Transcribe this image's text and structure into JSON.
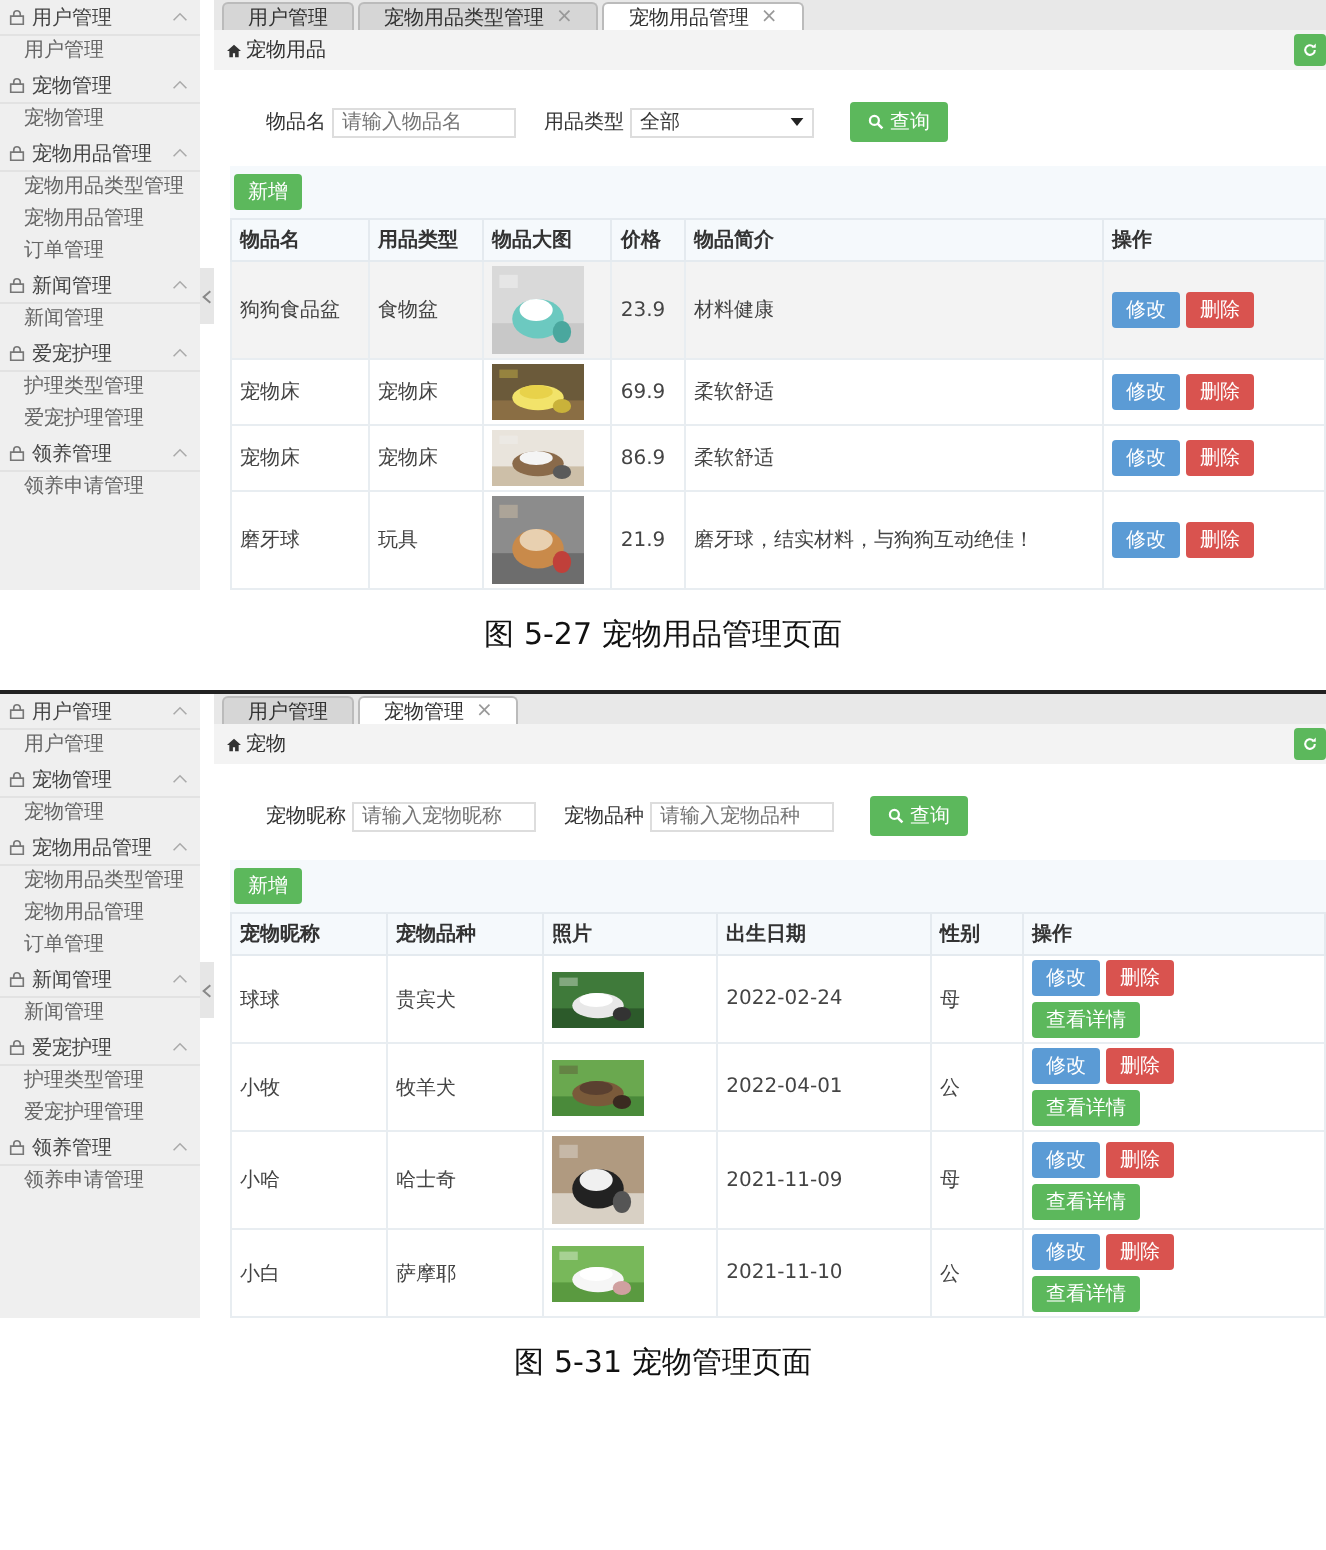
{
  "figures": [
    {
      "sidebar": [
        {
          "title": "用户管理",
          "expanded": true,
          "children": [
            "用户管理"
          ]
        },
        {
          "title": "宠物管理",
          "expanded": true,
          "children": [
            "宠物管理"
          ]
        },
        {
          "title": "宠物用品管理",
          "expanded": true,
          "children": [
            "宠物用品类型管理",
            "宠物用品管理",
            "订单管理"
          ]
        },
        {
          "title": "新闻管理",
          "expanded": true,
          "children": [
            "新闻管理"
          ]
        },
        {
          "title": "爱宠护理",
          "expanded": true,
          "children": [
            "护理类型管理",
            "爱宠护理管理"
          ]
        },
        {
          "title": "领养管理",
          "expanded": true,
          "children": [
            "领养申请管理"
          ]
        }
      ],
      "tabs": [
        {
          "label": "用户管理",
          "selected": false
        },
        {
          "label": "宠物用品类型管理",
          "close": "×",
          "selected": false
        },
        {
          "label": "宠物用品管理",
          "close": "×",
          "selected": true
        }
      ],
      "breadcrumb": "宠物用品",
      "filters": [
        {
          "kind": "input",
          "label": "物品名",
          "placeholder": "请输入物品名"
        },
        {
          "kind": "select",
          "label": "用品类型",
          "value": "全部"
        }
      ],
      "search_button": "查询",
      "add_button": "新增",
      "table": {
        "columns": [
          "物品名",
          "用品类型",
          "物品大图",
          "价格",
          "物品简介",
          "操作"
        ],
        "rows": [
          {
            "highlighted": true,
            "cells": [
              {
                "kind": "text",
                "text": "狗狗食品盆"
              },
              {
                "kind": "text",
                "text": "食物盆"
              },
              {
                "kind": "picture",
                "tall": true
              },
              {
                "kind": "text",
                "text": "23.9"
              },
              {
                "kind": "text",
                "text": "材料健康"
              },
              {
                "kind": "actions",
                "buttons": [
                  {
                    "kind": "edit",
                    "label": "修改"
                  },
                  {
                    "kind": "delete",
                    "label": "删除"
                  }
                ]
              }
            ]
          },
          {
            "highlighted": false,
            "cells": [
              {
                "kind": "text",
                "text": "宠物床"
              },
              {
                "kind": "text",
                "text": "宠物床"
              },
              {
                "kind": "picture",
                "tall": false
              },
              {
                "kind": "text",
                "text": "69.9"
              },
              {
                "kind": "text",
                "text": "柔软舒适"
              },
              {
                "kind": "actions",
                "buttons": [
                  {
                    "kind": "edit",
                    "label": "修改"
                  },
                  {
                    "kind": "delete",
                    "label": "删除"
                  }
                ]
              }
            ]
          },
          {
            "highlighted": false,
            "cells": [
              {
                "kind": "text",
                "text": "宠物床"
              },
              {
                "kind": "text",
                "text": "宠物床"
              },
              {
                "kind": "picture",
                "tall": false
              },
              {
                "kind": "text",
                "text": "86.9"
              },
              {
                "kind": "text",
                "text": "柔软舒适"
              },
              {
                "kind": "actions",
                "buttons": [
                  {
                    "kind": "edit",
                    "label": "修改"
                  },
                  {
                    "kind": "delete",
                    "label": "删除"
                  }
                ]
              }
            ]
          },
          {
            "highlighted": false,
            "cells": [
              {
                "kind": "text",
                "text": "磨牙球"
              },
              {
                "kind": "text",
                "text": "玩具"
              },
              {
                "kind": "picture",
                "tall": true
              },
              {
                "kind": "text",
                "text": "21.9"
              },
              {
                "kind": "text",
                "text": "磨牙球，结实材料，与狗狗互动绝佳！"
              },
              {
                "kind": "actions",
                "buttons": [
                  {
                    "kind": "edit",
                    "label": "修改"
                  },
                  {
                    "kind": "delete",
                    "label": "删除"
                  }
                ]
              }
            ]
          }
        ]
      },
      "caption": "图 5-27 宠物用品管理页面"
    },
    {
      "sidebar": [
        {
          "title": "用户管理",
          "expanded": true,
          "children": [
            "用户管理"
          ]
        },
        {
          "title": "宠物管理",
          "expanded": true,
          "children": [
            "宠物管理"
          ]
        },
        {
          "title": "宠物用品管理",
          "expanded": true,
          "children": [
            "宠物用品类型管理",
            "宠物用品管理",
            "订单管理"
          ]
        },
        {
          "title": "新闻管理",
          "expanded": true,
          "children": [
            "新闻管理"
          ]
        },
        {
          "title": "爱宠护理",
          "expanded": true,
          "children": [
            "护理类型管理",
            "爱宠护理管理"
          ]
        },
        {
          "title": "领养管理",
          "expanded": true,
          "children": [
            "领养申请管理"
          ]
        }
      ],
      "tabs": [
        {
          "label": "用户管理",
          "selected": false
        },
        {
          "label": "宠物管理",
          "close": "×",
          "selected": true
        }
      ],
      "breadcrumb": "宠物",
      "filters": [
        {
          "kind": "input",
          "label": "宠物昵称",
          "placeholder": "请输入宠物昵称"
        },
        {
          "kind": "input",
          "label": "宠物品种",
          "placeholder": "请输入宠物品种"
        }
      ],
      "search_button": "查询",
      "add_button": "新增",
      "table": {
        "columns": [
          "宠物昵称",
          "宠物品种",
          "照片",
          "出生日期",
          "性别",
          "操作"
        ],
        "rows": [
          {
            "highlighted": false,
            "cells": [
              {
                "kind": "text",
                "text": "球球"
              },
              {
                "kind": "text",
                "text": "贵宾犬"
              },
              {
                "kind": "picture",
                "tall": false
              },
              {
                "kind": "text",
                "text": "2022-02-24"
              },
              {
                "kind": "text",
                "text": "母"
              },
              {
                "kind": "actions",
                "buttons": [
                  {
                    "kind": "edit",
                    "label": "修改"
                  },
                  {
                    "kind": "delete",
                    "label": "删除"
                  },
                  {
                    "kind": "detail",
                    "label": "查看详情"
                  }
                ]
              }
            ]
          },
          {
            "highlighted": false,
            "cells": [
              {
                "kind": "text",
                "text": "小牧"
              },
              {
                "kind": "text",
                "text": "牧羊犬"
              },
              {
                "kind": "picture",
                "tall": false
              },
              {
                "kind": "text",
                "text": "2022-04-01"
              },
              {
                "kind": "text",
                "text": "公"
              },
              {
                "kind": "actions",
                "buttons": [
                  {
                    "kind": "edit",
                    "label": "修改"
                  },
                  {
                    "kind": "delete",
                    "label": "删除"
                  },
                  {
                    "kind": "detail",
                    "label": "查看详情"
                  }
                ]
              }
            ]
          },
          {
            "highlighted": false,
            "cells": [
              {
                "kind": "text",
                "text": "小哈"
              },
              {
                "kind": "text",
                "text": "哈士奇"
              },
              {
                "kind": "picture",
                "tall": true
              },
              {
                "kind": "text",
                "text": "2021-11-09"
              },
              {
                "kind": "text",
                "text": "母"
              },
              {
                "kind": "actions",
                "buttons": [
                  {
                    "kind": "edit",
                    "label": "修改"
                  },
                  {
                    "kind": "delete",
                    "label": "删除"
                  },
                  {
                    "kind": "detail",
                    "label": "查看详情"
                  }
                ]
              }
            ]
          },
          {
            "highlighted": false,
            "cells": [
              {
                "kind": "text",
                "text": "小白"
              },
              {
                "kind": "text",
                "text": "萨摩耶"
              },
              {
                "kind": "picture",
                "tall": false
              },
              {
                "kind": "text",
                "text": "2021-11-10"
              },
              {
                "kind": "text",
                "text": "公"
              },
              {
                "kind": "actions",
                "buttons": [
                  {
                    "kind": "edit",
                    "label": "修改"
                  },
                  {
                    "kind": "delete",
                    "label": "删除"
                  },
                  {
                    "kind": "detail",
                    "label": "查看详情"
                  }
                ]
              }
            ]
          }
        ]
      },
      "caption": "图 5-31 宠物管理页面"
    }
  ]
}
